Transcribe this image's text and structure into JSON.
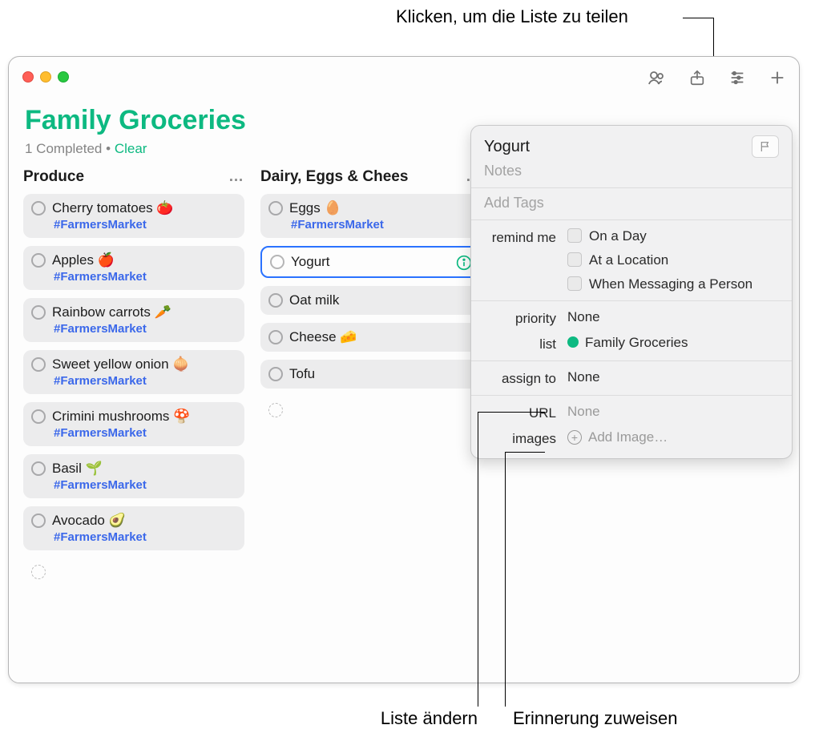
{
  "callouts": {
    "share": "Klicken, um die Liste zu teilen",
    "change_list": "Liste ändern",
    "assign": "Erinnerung zuweisen"
  },
  "toolbar": {
    "collab": "collaborate-icon",
    "share": "share-icon",
    "settings": "list-settings-icon",
    "add": "add-icon"
  },
  "list": {
    "title": "Family Groceries",
    "completed_count": "1 Completed",
    "sep": "•",
    "clear": "Clear"
  },
  "columns": [
    {
      "title": "Produce",
      "more": "…",
      "items": [
        {
          "label": "Cherry tomatoes 🍅",
          "tag": "#FarmersMarket"
        },
        {
          "label": "Apples 🍎",
          "tag": "#FarmersMarket"
        },
        {
          "label": "Rainbow carrots 🥕",
          "tag": "#FarmersMarket"
        },
        {
          "label": "Sweet yellow onion 🧅",
          "tag": "#FarmersMarket"
        },
        {
          "label": "Crimini mushrooms 🍄",
          "tag": "#FarmersMarket"
        },
        {
          "label": "Basil 🌱",
          "tag": "#FarmersMarket"
        },
        {
          "label": "Avocado 🥑",
          "tag": "#FarmersMarket"
        }
      ]
    },
    {
      "title": "Dairy, Eggs & Chees",
      "more": "…",
      "items": [
        {
          "label": "Eggs 🥚",
          "tag": "#FarmersMarket"
        },
        {
          "label": "Yogurt",
          "selected": true
        },
        {
          "label": "Oat milk"
        },
        {
          "label": "Cheese 🧀"
        },
        {
          "label": "Tofu"
        }
      ]
    }
  ],
  "details": {
    "title": "Yogurt",
    "notes_ph": "Notes",
    "tags_ph": "Add Tags",
    "remind_label": "remind me",
    "remind_options": {
      "day": "On a Day",
      "location": "At a Location",
      "messaging": "When Messaging a Person"
    },
    "priority_label": "priority",
    "priority_value": "None",
    "list_label": "list",
    "list_value": "Family Groceries",
    "assign_label": "assign to",
    "assign_value": "None",
    "url_label": "URL",
    "url_value": "None",
    "images_label": "images",
    "images_action": "Add Image…"
  }
}
